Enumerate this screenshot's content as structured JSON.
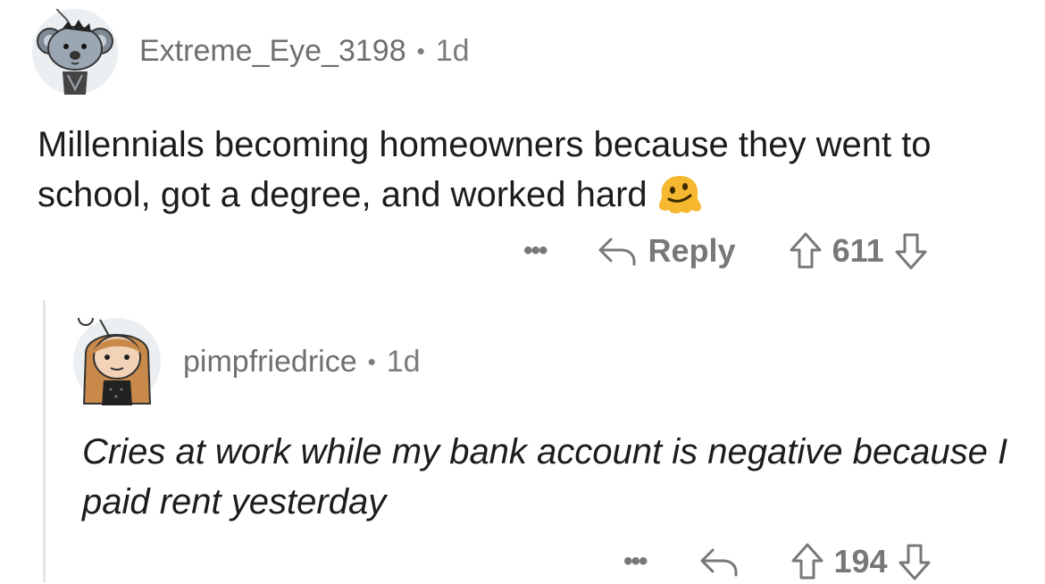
{
  "comments": [
    {
      "username": "Extreme_Eye_3198",
      "separator": "•",
      "age": "1d",
      "text": "Millennials becoming homeowners because they went to school, got a degree, and worked hard",
      "emoji": "melting-face-icon",
      "actions": {
        "more": "•••",
        "reply_label": "Reply",
        "score": "611"
      }
    },
    {
      "username": "pimpfriedrice",
      "separator": "•",
      "age": "1d",
      "text": "Cries at work while my bank account is negative because I paid rent yesterday",
      "actions": {
        "more": "•••",
        "score": "194"
      }
    }
  ],
  "colors": {
    "meta": "#7c7c7c",
    "icon": "#787878",
    "thread_line": "#e4e4e4"
  }
}
